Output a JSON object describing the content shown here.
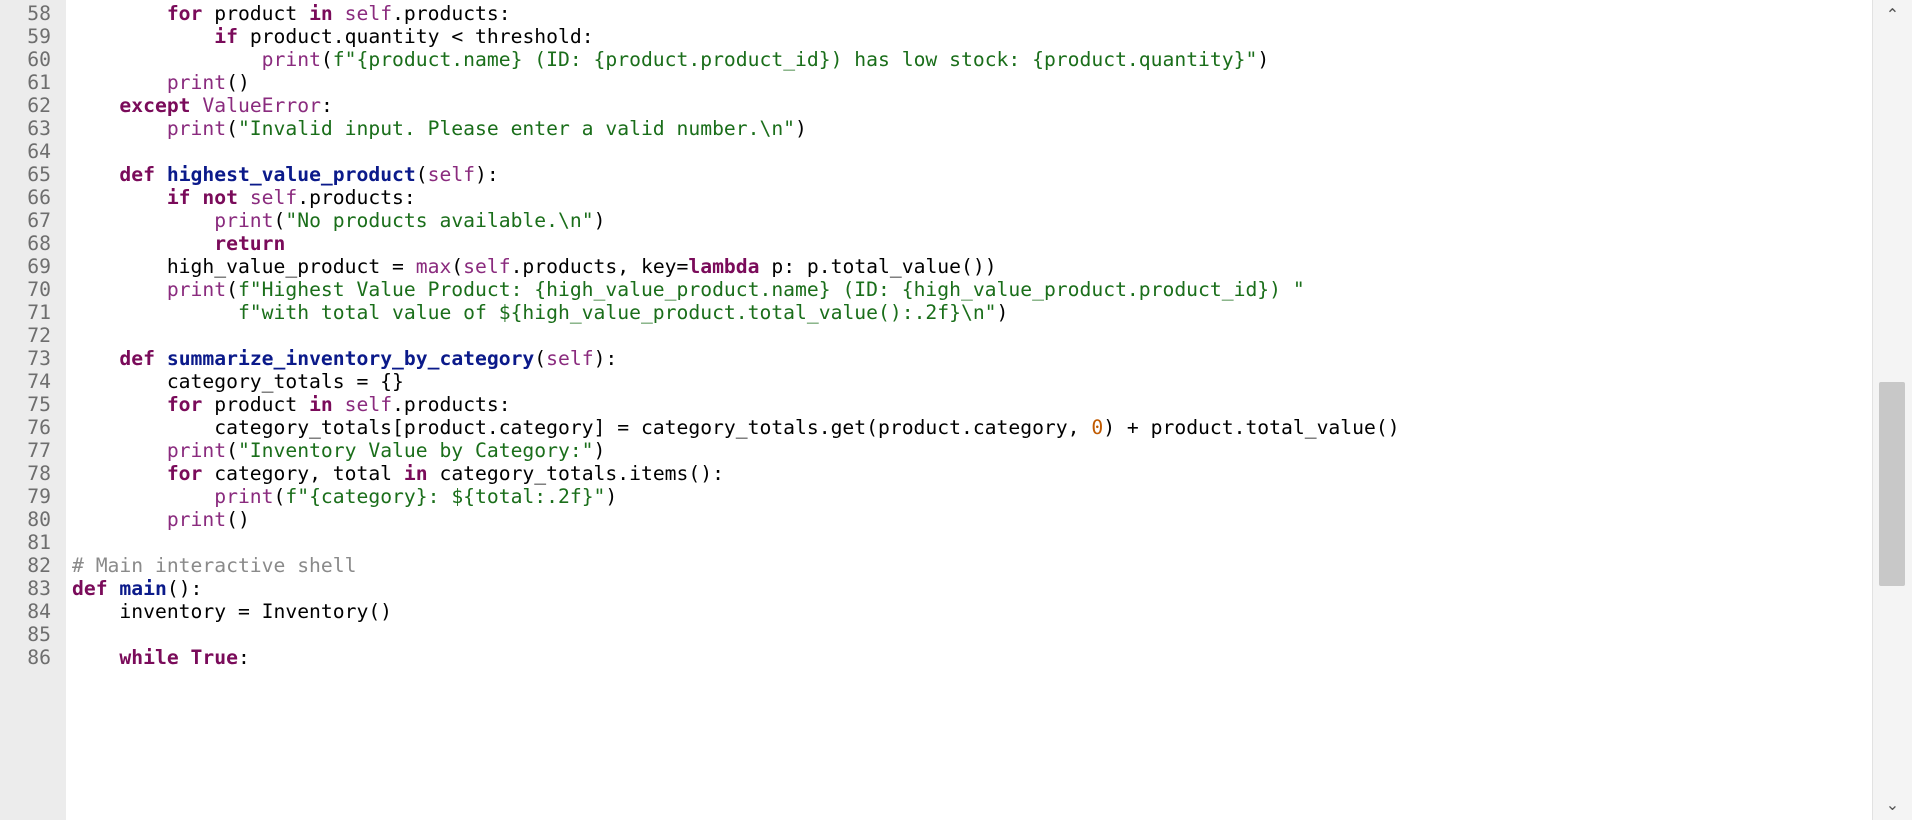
{
  "editor": {
    "language": "python",
    "lines": [
      {
        "number": "58",
        "tokens": [
          [
            "plain",
            "        "
          ],
          [
            "keyword",
            "for"
          ],
          [
            "plain",
            " product "
          ],
          [
            "keyword",
            "in"
          ],
          [
            "plain",
            " "
          ],
          [
            "self",
            "self"
          ],
          [
            "plain",
            ".products:"
          ]
        ]
      },
      {
        "number": "59",
        "tokens": [
          [
            "plain",
            "            "
          ],
          [
            "keyword",
            "if"
          ],
          [
            "plain",
            " product.quantity < threshold:"
          ]
        ]
      },
      {
        "number": "60",
        "tokens": [
          [
            "plain",
            "                "
          ],
          [
            "builtin",
            "print"
          ],
          [
            "plain",
            "("
          ],
          [
            "string",
            "f\"{product.name} (ID: {product.product_id}) has low stock: {product.quantity}\""
          ],
          [
            "plain",
            ")"
          ]
        ]
      },
      {
        "number": "61",
        "tokens": [
          [
            "plain",
            "        "
          ],
          [
            "builtin",
            "print"
          ],
          [
            "plain",
            "()"
          ]
        ]
      },
      {
        "number": "62",
        "tokens": [
          [
            "plain",
            "    "
          ],
          [
            "keyword",
            "except"
          ],
          [
            "plain",
            " "
          ],
          [
            "exception",
            "ValueError"
          ],
          [
            "plain",
            ":"
          ]
        ]
      },
      {
        "number": "63",
        "tokens": [
          [
            "plain",
            "        "
          ],
          [
            "builtin",
            "print"
          ],
          [
            "plain",
            "("
          ],
          [
            "string",
            "\"Invalid input. Please enter a valid number.\\n\""
          ],
          [
            "plain",
            ")"
          ]
        ]
      },
      {
        "number": "64",
        "tokens": []
      },
      {
        "number": "65",
        "tokens": [
          [
            "plain",
            "    "
          ],
          [
            "keyword",
            "def"
          ],
          [
            "plain",
            " "
          ],
          [
            "funcdef",
            "highest_value_product"
          ],
          [
            "plain",
            "("
          ],
          [
            "self",
            "self"
          ],
          [
            "plain",
            "):"
          ]
        ]
      },
      {
        "number": "66",
        "tokens": [
          [
            "plain",
            "        "
          ],
          [
            "keyword",
            "if not"
          ],
          [
            "plain",
            " "
          ],
          [
            "self",
            "self"
          ],
          [
            "plain",
            ".products:"
          ]
        ]
      },
      {
        "number": "67",
        "tokens": [
          [
            "plain",
            "            "
          ],
          [
            "builtin",
            "print"
          ],
          [
            "plain",
            "("
          ],
          [
            "string",
            "\"No products available.\\n\""
          ],
          [
            "plain",
            ")"
          ]
        ]
      },
      {
        "number": "68",
        "tokens": [
          [
            "plain",
            "            "
          ],
          [
            "keyword",
            "return"
          ]
        ]
      },
      {
        "number": "69",
        "tokens": [
          [
            "plain",
            "        high_value_product = "
          ],
          [
            "builtin",
            "max"
          ],
          [
            "plain",
            "("
          ],
          [
            "self",
            "self"
          ],
          [
            "plain",
            ".products, key="
          ],
          [
            "keyword",
            "lambda"
          ],
          [
            "plain",
            " p: p.total_value())"
          ]
        ]
      },
      {
        "number": "70",
        "tokens": [
          [
            "plain",
            "        "
          ],
          [
            "builtin",
            "print"
          ],
          [
            "plain",
            "("
          ],
          [
            "string",
            "f\"Highest Value Product: {high_value_product.name} (ID: {high_value_product.product_id}) \""
          ]
        ]
      },
      {
        "number": "71",
        "tokens": [
          [
            "plain",
            "              "
          ],
          [
            "string",
            "f\"with total value of ${high_value_product.total_value():.2f}\\n\""
          ],
          [
            "plain",
            ")"
          ]
        ]
      },
      {
        "number": "72",
        "tokens": []
      },
      {
        "number": "73",
        "tokens": [
          [
            "plain",
            "    "
          ],
          [
            "keyword",
            "def"
          ],
          [
            "plain",
            " "
          ],
          [
            "funcdef",
            "summarize_inventory_by_category"
          ],
          [
            "plain",
            "("
          ],
          [
            "self",
            "self"
          ],
          [
            "plain",
            "):"
          ]
        ]
      },
      {
        "number": "74",
        "tokens": [
          [
            "plain",
            "        category_totals = {}"
          ]
        ]
      },
      {
        "number": "75",
        "tokens": [
          [
            "plain",
            "        "
          ],
          [
            "keyword",
            "for"
          ],
          [
            "plain",
            " product "
          ],
          [
            "keyword",
            "in"
          ],
          [
            "plain",
            " "
          ],
          [
            "self",
            "self"
          ],
          [
            "plain",
            ".products:"
          ]
        ]
      },
      {
        "number": "76",
        "tokens": [
          [
            "plain",
            "            category_totals[product.category] = category_totals.get(product.category, "
          ],
          [
            "number",
            "0"
          ],
          [
            "plain",
            ") + product.total_value()"
          ]
        ]
      },
      {
        "number": "77",
        "tokens": [
          [
            "plain",
            "        "
          ],
          [
            "builtin",
            "print"
          ],
          [
            "plain",
            "("
          ],
          [
            "string",
            "\"Inventory Value by Category:\""
          ],
          [
            "plain",
            ")"
          ]
        ]
      },
      {
        "number": "78",
        "tokens": [
          [
            "plain",
            "        "
          ],
          [
            "keyword",
            "for"
          ],
          [
            "plain",
            " category, total "
          ],
          [
            "keyword",
            "in"
          ],
          [
            "plain",
            " category_totals.items():"
          ]
        ]
      },
      {
        "number": "79",
        "tokens": [
          [
            "plain",
            "            "
          ],
          [
            "builtin",
            "print"
          ],
          [
            "plain",
            "("
          ],
          [
            "string",
            "f\"{category}: ${total:.2f}\""
          ],
          [
            "plain",
            ")"
          ]
        ]
      },
      {
        "number": "80",
        "tokens": [
          [
            "plain",
            "        "
          ],
          [
            "builtin",
            "print"
          ],
          [
            "plain",
            "()"
          ]
        ]
      },
      {
        "number": "81",
        "tokens": []
      },
      {
        "number": "82",
        "tokens": [
          [
            "comment",
            "# Main interactive shell"
          ]
        ]
      },
      {
        "number": "83",
        "tokens": [
          [
            "keyword",
            "def"
          ],
          [
            "plain",
            " "
          ],
          [
            "funcdef",
            "main"
          ],
          [
            "plain",
            "():"
          ]
        ]
      },
      {
        "number": "84",
        "tokens": [
          [
            "plain",
            "    inventory = Inventory()"
          ]
        ]
      },
      {
        "number": "85",
        "tokens": []
      },
      {
        "number": "86",
        "tokens": [
          [
            "plain",
            "    "
          ],
          [
            "keyword",
            "while"
          ],
          [
            "plain",
            " "
          ],
          [
            "keyword",
            "True"
          ],
          [
            "plain",
            ":"
          ]
        ]
      }
    ]
  },
  "scrollbar": {
    "up_icon": "chevron-up-icon",
    "down_icon": "chevron-down-icon",
    "position_fraction": 0.5
  },
  "colors": {
    "keyword": "#7a0b5a",
    "function_name": "#0b1a8a",
    "string": "#1a6e1a",
    "number": "#c05a00",
    "comment": "#8a8a8a",
    "gutter_background": "#ececec"
  }
}
